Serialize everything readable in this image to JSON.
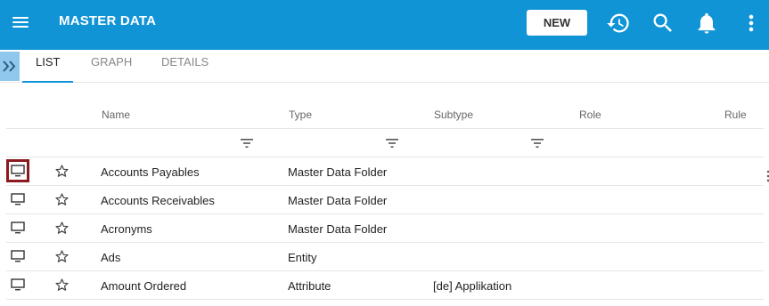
{
  "header": {
    "title": "MASTER DATA",
    "new_label": "NEW",
    "background": "#1194d6",
    "icons": [
      "menu-icon",
      "history-icon",
      "search-icon",
      "bell-icon",
      "more-vert-icon"
    ]
  },
  "tabs": [
    {
      "label": "LIST",
      "active": true
    },
    {
      "label": "GRAPH",
      "active": false
    },
    {
      "label": "DETAILS",
      "active": false
    }
  ],
  "table": {
    "columns": [
      "Name",
      "Type",
      "Subtype",
      "Role",
      "Rule"
    ],
    "rows": [
      {
        "name": "Accounts Payables",
        "type": "Master Data Folder",
        "subtype": "",
        "selected": true
      },
      {
        "name": "Accounts Receivables",
        "type": "Master Data Folder",
        "subtype": "",
        "selected": false
      },
      {
        "name": "Acronyms",
        "type": "Master Data Folder",
        "subtype": "",
        "selected": false
      },
      {
        "name": "Ads",
        "type": "Entity",
        "subtype": "",
        "selected": false
      },
      {
        "name": "Amount Ordered",
        "type": "Attribute",
        "subtype": "[de] Applikation",
        "selected": false
      }
    ]
  },
  "colors": {
    "accent": "#1194d6",
    "selected_border": "#8b1a1f",
    "expand_button": "#8fc8ec"
  }
}
